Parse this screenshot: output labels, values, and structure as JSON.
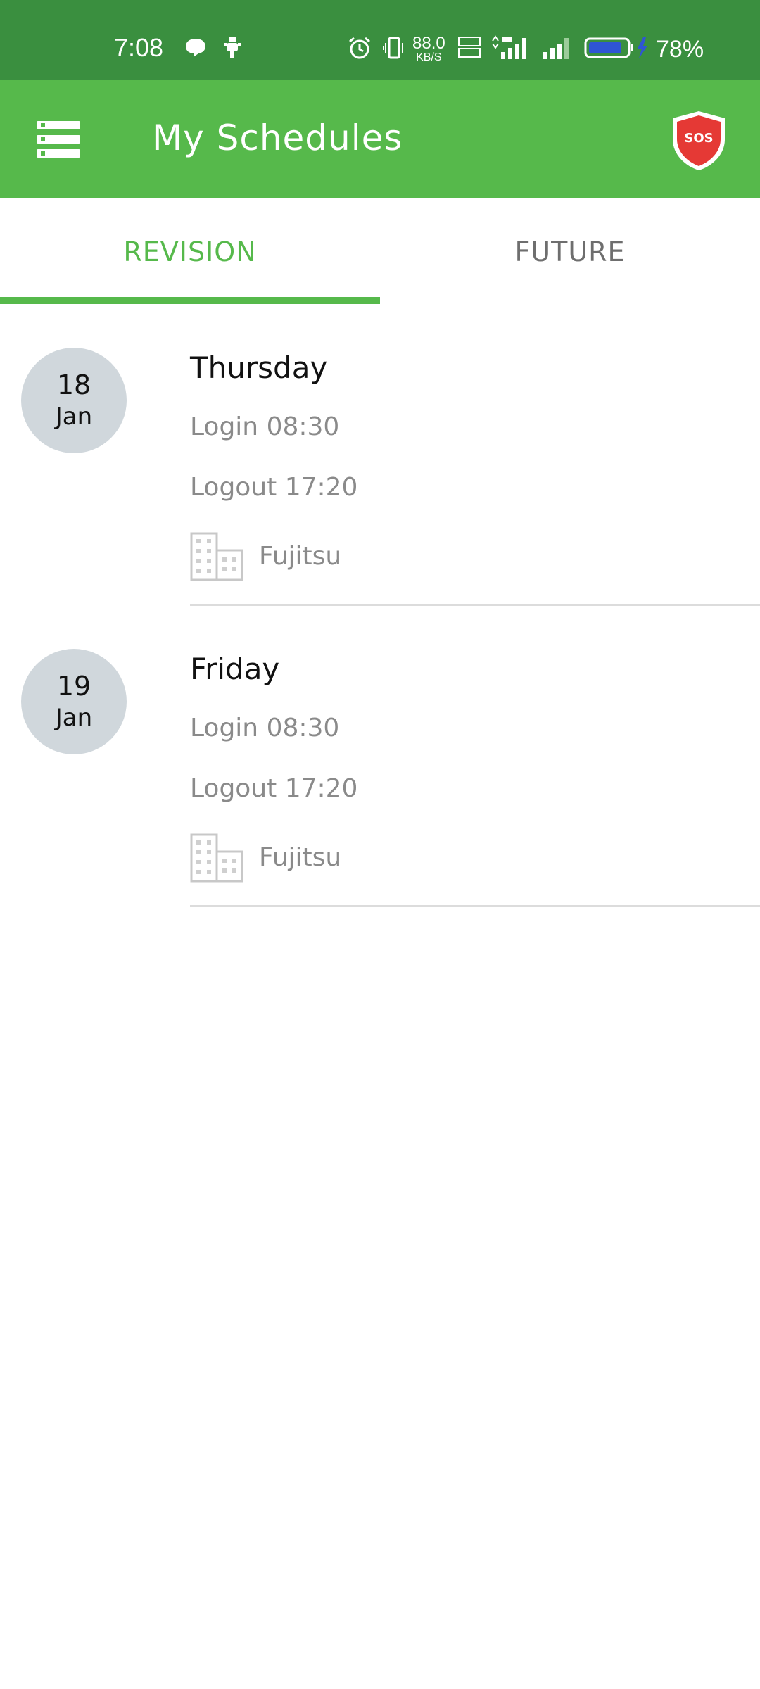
{
  "status_bar": {
    "time": "7:08",
    "speed_value": "88.0",
    "speed_unit": "KB/S",
    "battery_percent": "78%"
  },
  "app_bar": {
    "title": "My Schedules",
    "sos_label": "SOS"
  },
  "tabs": [
    {
      "label": "REVISION",
      "active": true
    },
    {
      "label": "FUTURE",
      "active": false
    }
  ],
  "schedules": [
    {
      "day": "18",
      "month": "Jan",
      "weekday": "Thursday",
      "login": "Login 08:30",
      "logout": "Logout 17:20",
      "company": "Fujitsu"
    },
    {
      "day": "19",
      "month": "Jan",
      "weekday": "Friday",
      "login": "Login 08:30",
      "logout": "Logout 17:20",
      "company": "Fujitsu"
    }
  ],
  "colors": {
    "primary": "#56b94b",
    "status_bar": "#3a8f3f",
    "date_badge": "#d0d7dc",
    "sos_red": "#e53935"
  },
  "icons": {
    "menu": "menu-icon",
    "sos": "sos-shield-icon",
    "company": "building-icon"
  }
}
